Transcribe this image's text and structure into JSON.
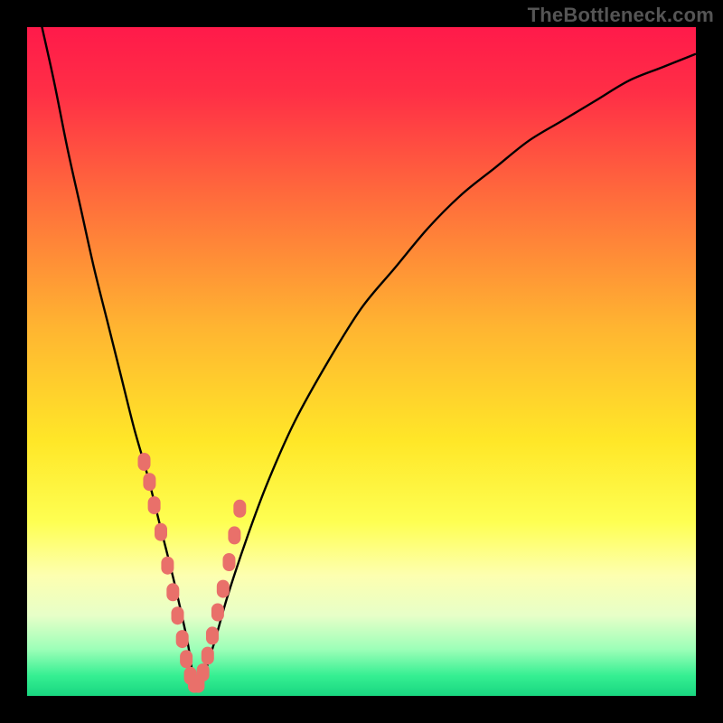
{
  "watermark": "TheBottleneck.com",
  "colors": {
    "frame": "#000000",
    "curve": "#000000",
    "marker": "#e9706a",
    "gradient_stops": [
      {
        "pct": 0,
        "color": "#ff1a4a"
      },
      {
        "pct": 10,
        "color": "#ff2f46"
      },
      {
        "pct": 25,
        "color": "#ff6a3c"
      },
      {
        "pct": 45,
        "color": "#ffb531"
      },
      {
        "pct": 62,
        "color": "#ffe728"
      },
      {
        "pct": 74,
        "color": "#feff52"
      },
      {
        "pct": 82,
        "color": "#fdffb0"
      },
      {
        "pct": 88,
        "color": "#e7ffc8"
      },
      {
        "pct": 93,
        "color": "#9dffb8"
      },
      {
        "pct": 97,
        "color": "#35ef92"
      },
      {
        "pct": 100,
        "color": "#19d680"
      }
    ]
  },
  "chart_data": {
    "type": "line",
    "title": "",
    "xlabel": "",
    "ylabel": "",
    "xlim": [
      0,
      100
    ],
    "ylim": [
      0,
      100
    ],
    "series": [
      {
        "name": "bottleneck-curve",
        "x": [
          2,
          4,
          6,
          8,
          10,
          12,
          14,
          16,
          18,
          20,
          22,
          24,
          25,
          26,
          28,
          30,
          33,
          36,
          40,
          45,
          50,
          55,
          60,
          65,
          70,
          75,
          80,
          85,
          90,
          95,
          100
        ],
        "y": [
          101,
          92,
          82,
          73,
          64,
          56,
          48,
          40,
          33,
          25,
          17,
          8,
          2,
          2,
          8,
          15,
          24,
          32,
          41,
          50,
          58,
          64,
          70,
          75,
          79,
          83,
          86,
          89,
          92,
          94,
          96
        ]
      }
    ],
    "markers": {
      "name": "highlighted-points",
      "x": [
        17.5,
        18.3,
        19.0,
        20.0,
        21.0,
        21.8,
        22.5,
        23.2,
        23.8,
        24.4,
        25.0,
        25.6,
        26.3,
        27.0,
        27.7,
        28.5,
        29.3,
        30.2,
        31.0,
        31.8
      ],
      "y": [
        35,
        32,
        28.5,
        24.5,
        19.5,
        15.5,
        12,
        8.5,
        5.5,
        3,
        1.8,
        1.8,
        3.5,
        6,
        9,
        12.5,
        16,
        20,
        24,
        28
      ]
    },
    "minimum_x": 25,
    "minimum_y": 1.8
  }
}
